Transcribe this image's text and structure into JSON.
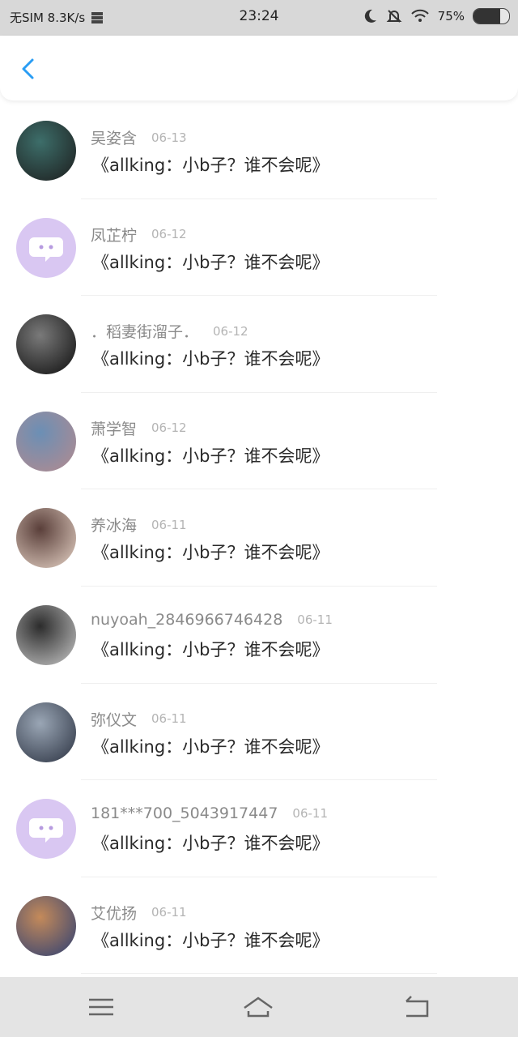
{
  "status_bar": {
    "carrier": "无SIM 8.3K/s",
    "time": "23:24",
    "battery_text": "75%",
    "battery_level": 0.75,
    "icons": [
      "sim-icon",
      "storage-icon",
      "moon-icon",
      "mute-icon",
      "wifi-icon",
      "battery-icon"
    ]
  },
  "header": {
    "back_icon": "back-chevron-icon"
  },
  "colors": {
    "accent": "#2a9df4",
    "placeholder_avatar": "#d9c7f2"
  },
  "items": [
    {
      "name": "吴姿含",
      "date": "06-13",
      "message": "《allking：小b子？谁不会呢》",
      "avatar": "photo"
    },
    {
      "name": "凤芷柠",
      "date": "06-12",
      "message": "《allking：小b子？谁不会呢》",
      "avatar": "default"
    },
    {
      "name": "．稻妻街溜子．",
      "date": "06-12",
      "message": "《allking：小b子？谁不会呢》",
      "avatar": "photo"
    },
    {
      "name": "萧学智",
      "date": "06-12",
      "message": "《allking：小b子？谁不会呢》",
      "avatar": "photo"
    },
    {
      "name": "养冰海",
      "date": "06-11",
      "message": "《allking：小b子？谁不会呢》",
      "avatar": "photo"
    },
    {
      "name": "nuyoah_2846966746428",
      "date": "06-11",
      "message": "《allking：小b子？谁不会呢》",
      "avatar": "photo"
    },
    {
      "name": "弥仪文",
      "date": "06-11",
      "message": "《allking：小b子？谁不会呢》",
      "avatar": "photo"
    },
    {
      "name": "181***700_5043917447",
      "date": "06-11",
      "message": "《allking：小b子？谁不会呢》",
      "avatar": "default"
    },
    {
      "name": "艾优扬",
      "date": "06-11",
      "message": "《allking：小b子？谁不会呢》",
      "avatar": "photo"
    }
  ],
  "navbar": {
    "icons": [
      "menu-icon",
      "home-icon",
      "back-icon"
    ]
  }
}
